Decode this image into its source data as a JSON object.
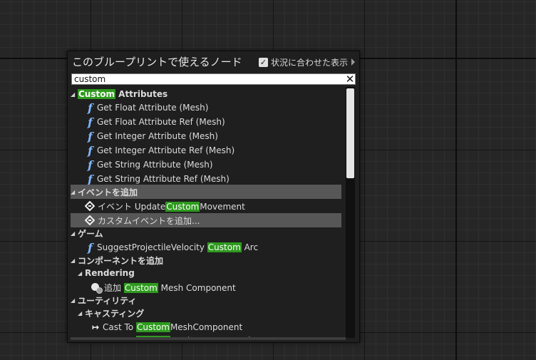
{
  "panel": {
    "title": "このブループリントで使えるノード",
    "context_sensitive_label": "状況に合わせた表示",
    "context_sensitive_checked": true,
    "checkmark": "✓",
    "search_value": "custom",
    "clear_glyph": "✕"
  },
  "items": [
    {
      "kind": "category",
      "indent": 0,
      "parts": [
        {
          "t": "Custom",
          "hl": true
        },
        {
          "t": " Attributes"
        }
      ]
    },
    {
      "kind": "function",
      "indent": 1,
      "parts": [
        {
          "t": "Get Float Attribute (Mesh)"
        }
      ]
    },
    {
      "kind": "function",
      "indent": 1,
      "parts": [
        {
          "t": "Get Float Attribute Ref (Mesh)"
        }
      ]
    },
    {
      "kind": "function",
      "indent": 1,
      "parts": [
        {
          "t": "Get Integer Attribute (Mesh)"
        }
      ]
    },
    {
      "kind": "function",
      "indent": 1,
      "parts": [
        {
          "t": "Get Integer Attribute Ref (Mesh)"
        }
      ]
    },
    {
      "kind": "function",
      "indent": 1,
      "parts": [
        {
          "t": "Get String Attribute (Mesh)"
        }
      ]
    },
    {
      "kind": "function",
      "indent": 1,
      "parts": [
        {
          "t": "Get String Attribute Ref (Mesh)"
        }
      ]
    },
    {
      "kind": "category",
      "indent": 0,
      "selected": true,
      "parts": [
        {
          "t": "イベントを追加"
        }
      ]
    },
    {
      "kind": "event",
      "indent": 1,
      "parts": [
        {
          "t": "イベント Update"
        },
        {
          "t": "Custom",
          "hl": true
        },
        {
          "t": "Movement"
        }
      ]
    },
    {
      "kind": "event",
      "indent": 1,
      "selected": true,
      "parts": [
        {
          "t": "カスタムイベントを追加..."
        }
      ]
    },
    {
      "kind": "category",
      "indent": 0,
      "parts": [
        {
          "t": "ゲーム"
        }
      ]
    },
    {
      "kind": "function",
      "indent": 1,
      "parts": [
        {
          "t": "SuggestProjectileVelocity "
        },
        {
          "t": "Custom",
          "hl": true
        },
        {
          "t": " Arc"
        }
      ]
    },
    {
      "kind": "category",
      "indent": 0,
      "parts": [
        {
          "t": "コンポーネントを追加"
        }
      ]
    },
    {
      "kind": "category",
      "indent": 1,
      "parts": [
        {
          "t": "Rendering"
        }
      ]
    },
    {
      "kind": "component",
      "indent": 2,
      "parts": [
        {
          "t": "追加 "
        },
        {
          "t": "Custom",
          "hl": true
        },
        {
          "t": " Mesh Component"
        }
      ]
    },
    {
      "kind": "category",
      "indent": 0,
      "parts": [
        {
          "t": "ユーティリティ"
        }
      ]
    },
    {
      "kind": "category",
      "indent": 1,
      "parts": [
        {
          "t": "キャスティング"
        }
      ]
    },
    {
      "kind": "cast",
      "indent": 2,
      "parts": [
        {
          "t": "Cast To "
        },
        {
          "t": "Custom",
          "hl": true
        },
        {
          "t": "MeshComponent"
        }
      ]
    },
    {
      "kind": "cast",
      "indent": 2,
      "parts": [
        {
          "t": "Cast To "
        },
        {
          "t": "Custom",
          "hl": true
        },
        {
          "t": "MeshComponent クラス"
        }
      ]
    }
  ],
  "colors": {
    "highlight": "#2e9a1e",
    "function_icon": "#7fb7ff",
    "selected_row": "#575757"
  }
}
